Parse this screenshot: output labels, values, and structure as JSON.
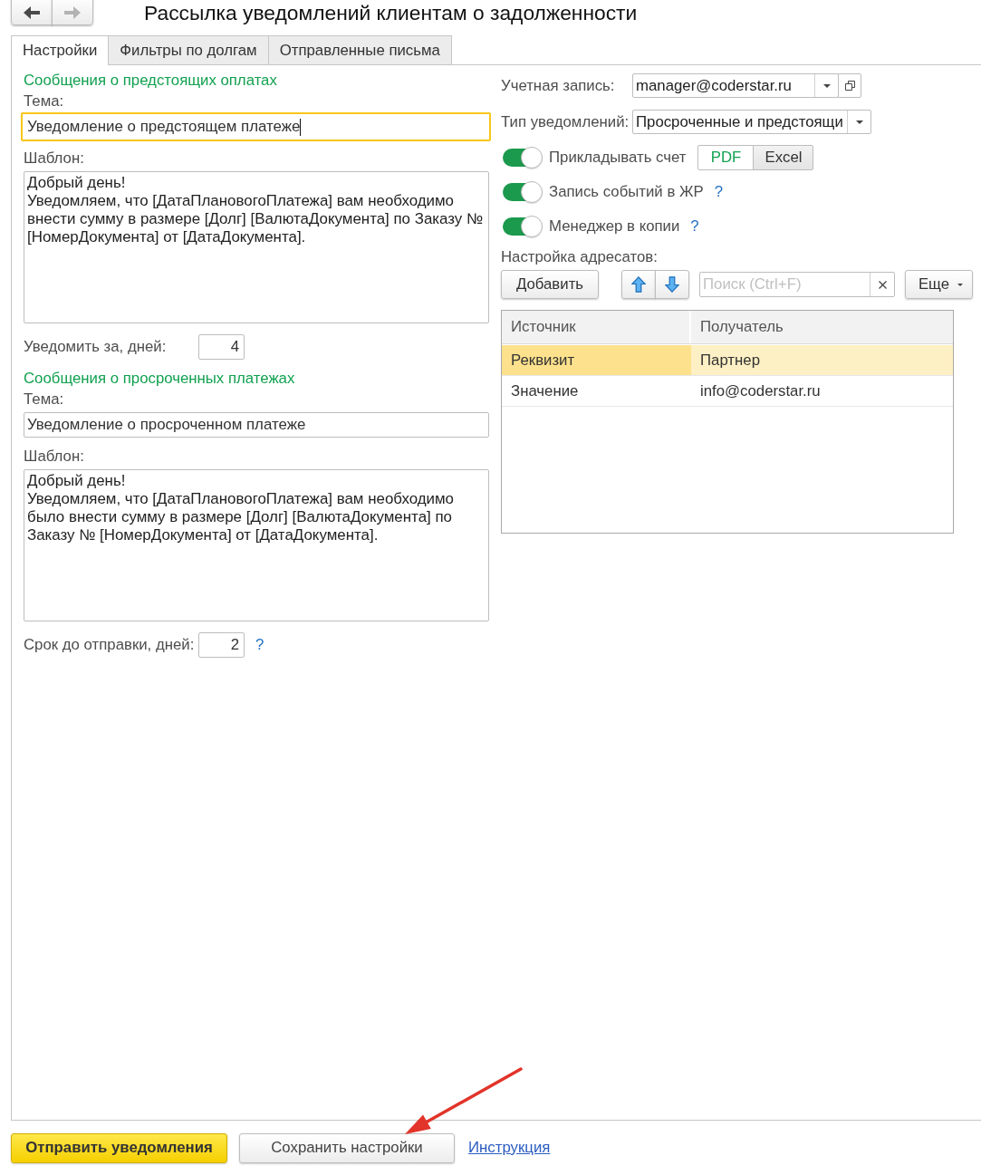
{
  "nav": {
    "back": {
      "disabled": false
    },
    "forward": {
      "disabled": true
    }
  },
  "window": {
    "title": "Рассылка уведомлений клиентам о задолженности"
  },
  "tabs": [
    {
      "label": "Настройки",
      "selected": true
    },
    {
      "label": "Фильтры по долгам",
      "selected": false
    },
    {
      "label": "Отправленные письма",
      "selected": false
    }
  ],
  "left_sections": [
    {
      "heading": "Сообщения о предстоящих оплатах",
      "subject_label": "Тема:",
      "subject": {
        "value": "Уведомление о предстоящем платеже",
        "focused": true
      },
      "template_label": "Шаблон:",
      "template": "Добрый день!\nУведомляем, что [ДатаПлановогоПлатежа] вам необходимо внести сумму в размере [Долг] [ВалютаДокумента] по Заказу № [НомерДокумента] от [ДатаДокумента].",
      "days": {
        "label": "Уведомить за, дней:",
        "value": "4"
      }
    },
    {
      "heading": "Сообщения о просроченных платежах",
      "subject_label": "Тема:",
      "subject": {
        "value": "Уведомление о просроченном платеже",
        "focused": false
      },
      "template_label": "Шаблон:",
      "template": "Добрый день!\nУведомляем, что [ДатаПлановогоПлатежа] вам необходимо было внести сумму в размере [Долг] [ВалютаДокумента] по Заказу № [НомерДокумента] от [ДатаДокумента].",
      "days": {
        "label": "Срок до отправки, дней:",
        "value": "2",
        "help": "?"
      }
    }
  ],
  "account": {
    "label": "Учетная запись:",
    "value": "manager@coderstar.ru"
  },
  "notification_type": {
    "label": "Тип уведомлений:",
    "value": "Просроченные и предстоящи"
  },
  "switches": [
    {
      "kind": "formats",
      "label": "Прикладывать счет",
      "on": true,
      "formats": [
        {
          "label": "PDF",
          "selected": true
        },
        {
          "label": "Excel",
          "selected": false
        }
      ]
    },
    {
      "kind": "help",
      "label": "Запись событий в ЖР",
      "on": true,
      "help": "?"
    },
    {
      "kind": "help",
      "label": "Менеджер в копии",
      "on": true,
      "help": "?"
    }
  ],
  "recipients": {
    "label": "Настройка адресатов:",
    "toolbar": {
      "add": "Добавить",
      "search_placeholder": "Поиск (Ctrl+F)",
      "more": "Еще"
    },
    "table": {
      "columns": [
        "Источник",
        "Получатель"
      ],
      "rows": [
        {
          "selected": true,
          "cells": [
            {
              "text": "Реквизит",
              "focused": true
            },
            {
              "text": "Партнер",
              "focused": false
            }
          ]
        },
        {
          "selected": false,
          "cells": [
            {
              "text": "Значение",
              "focused": false
            },
            {
              "text": "info@coderstar.ru",
              "focused": false
            }
          ]
        }
      ]
    }
  },
  "footer": {
    "buttons": [
      {
        "kind": "primary",
        "label": "Отправить уведомления"
      },
      {
        "kind": "default",
        "label": "Сохранить настройки"
      }
    ],
    "link": "Инструкция"
  }
}
